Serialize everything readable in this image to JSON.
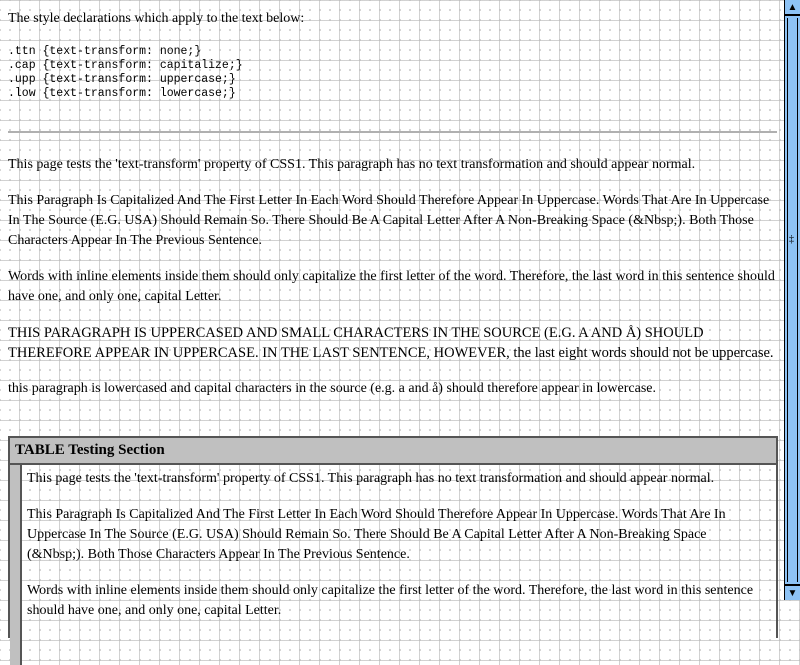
{
  "intro": "The style declarations which apply to the text below:",
  "code": [
    ".ttn {text-transform: none;}",
    ".cap {text-transform: capitalize;}",
    ".upp {text-transform: uppercase;}",
    ".low {text-transform: lowercase;}"
  ],
  "paras": {
    "p1": "This page tests the 'text-transform' property of CSS1. This paragraph has no text transformation and should appear normal.",
    "p2": "This Paragraph Is Capitalized And The First Letter In Each Word Should Therefore Appear In Uppercase. Words That Are In Uppercase In The Source (E.G. USA) Should Remain So. There Should Be A Capital Letter After A Non-Breaking Space (&Nbsp;). Both Those Characters Appear In The Previous Sentence.",
    "p3": "Words with inline elements inside them should only capitalize the first letter of the word. Therefore, the last word in this sentence should have one, and only one, capital Letter.",
    "p4_upper": "THIS PARAGRAPH IS UPPERCASED AND SMALL CHARACTERS IN THE SOURCE (E.G. A AND Å) SHOULD THEREFORE APPEAR IN UPPERCASE. IN THE LAST SENTENCE, HOWEVER,",
    "p4_normal": " the last eight words should not be uppercase.",
    "p5": "this paragraph is lowercased and capital characters in the source (e.g. a and å) should therefore appear in lowercase."
  },
  "table": {
    "header": "TABLE Testing Section",
    "p1": "This page tests the 'text-transform' property of CSS1. This paragraph has no text transformation and should appear normal.",
    "p2": "This Paragraph Is Capitalized And The First Letter In Each Word Should Therefore Appear In Uppercase. Words That Are In Uppercase In The Source (E.G. USA) Should Remain So. There Should Be A Capital Letter After A Non-Breaking Space (&Nbsp;). Both Those Characters Appear In The Previous Sentence.",
    "p3": "Words with inline elements inside them should only capitalize the first letter of the word. Therefore, the last word in this sentence should have one, and only one, capital Letter."
  },
  "scrollbar": {
    "up": "▲",
    "down": "▼",
    "position": 0
  }
}
